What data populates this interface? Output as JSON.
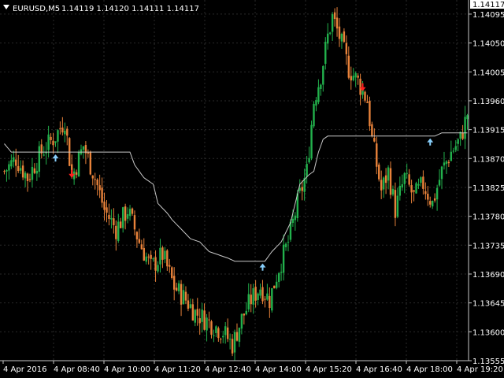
{
  "header": {
    "symbol": "EURUSD,M5",
    "ohlc": "1.14119 1.14120 1.14111 1.14117",
    "collapse_icon": "triangle-down-icon"
  },
  "colors": {
    "background": "#000000",
    "grid": "#2a2a2a",
    "bull": "#22b14c",
    "bear": "#e8823a",
    "ma_line": "#c8c8c8",
    "buy_arrow": "#87cefa",
    "sell_arrow": "#ff2020",
    "axis_text": "#ffffff"
  },
  "chart_data": {
    "type": "candlestick",
    "grid": true,
    "ylim": [
      1.13555,
      1.14117
    ],
    "current_price": "1.14117",
    "y_ticks": [
      "1.14095",
      "1.14050",
      "1.14005",
      "1.13960",
      "1.13915",
      "1.13870",
      "1.13825",
      "1.13780",
      "1.13735",
      "1.13690",
      "1.13645",
      "1.13600",
      "1.13555"
    ],
    "x_ticks": [
      "4 Apr 2016",
      "4 Apr 08:40",
      "4 Apr 10:00",
      "4 Apr 11:20",
      "4 Apr 12:40",
      "4 Apr 14:00",
      "4 Apr 15:20",
      "4 Apr 16:40",
      "4 Apr 18:00",
      "4 Apr 19:20"
    ],
    "close_path": [
      [
        0,
        1.1385
      ],
      [
        5,
        1.1387
      ],
      [
        10,
        1.1384
      ],
      [
        16,
        1.1388
      ],
      [
        22,
        1.13905
      ],
      [
        26,
        1.1393
      ],
      [
        29,
        1.1384
      ],
      [
        34,
        1.1389
      ],
      [
        39,
        1.1384
      ],
      [
        43,
        1.1379
      ],
      [
        48,
        1.1376
      ],
      [
        53,
        1.1379
      ],
      [
        58,
        1.1374
      ],
      [
        63,
        1.137
      ],
      [
        68,
        1.1372
      ],
      [
        73,
        1.1367
      ],
      [
        78,
        1.1365
      ],
      [
        82,
        1.1363
      ],
      [
        86,
        1.1362
      ],
      [
        90,
        1.1361
      ],
      [
        94,
        1.136
      ],
      [
        98,
        1.1358
      ],
      [
        102,
        1.1362
      ],
      [
        106,
        1.1365
      ],
      [
        110,
        1.1367
      ],
      [
        114,
        1.1365
      ],
      [
        118,
        1.137
      ],
      [
        122,
        1.1374
      ],
      [
        126,
        1.138
      ],
      [
        130,
        1.1385
      ],
      [
        133,
        1.1396
      ],
      [
        136,
        1.14
      ],
      [
        139,
        1.1406
      ],
      [
        141,
        1.1409
      ],
      [
        144,
        1.1406
      ],
      [
        148,
        1.1401
      ],
      [
        152,
        1.1399
      ],
      [
        156,
        1.1396
      ],
      [
        158,
        1.139
      ],
      [
        160,
        1.1386
      ],
      [
        162,
        1.1382
      ],
      [
        165,
        1.1385
      ],
      [
        168,
        1.1379
      ],
      [
        172,
        1.1384
      ],
      [
        176,
        1.1381
      ],
      [
        180,
        1.1383
      ],
      [
        184,
        1.138
      ],
      [
        188,
        1.1385
      ],
      [
        192,
        1.1388
      ],
      [
        196,
        1.139
      ],
      [
        199,
        1.1394
      ]
    ],
    "moving_average": [
      [
        0,
        1.13893
      ],
      [
        3,
        1.1388
      ],
      [
        40,
        1.1388
      ],
      [
        54,
        1.1388
      ],
      [
        56,
        1.1386
      ],
      [
        60,
        1.1384
      ],
      [
        64,
        1.1383
      ],
      [
        66,
        1.138
      ],
      [
        70,
        1.13785
      ],
      [
        72,
        1.13775
      ],
      [
        80,
        1.13745
      ],
      [
        84,
        1.1374
      ],
      [
        88,
        1.13725
      ],
      [
        92,
        1.1372
      ],
      [
        96,
        1.13715
      ],
      [
        99,
        1.1371
      ],
      [
        112,
        1.1371
      ],
      [
        113,
        1.13715
      ],
      [
        115,
        1.13725
      ],
      [
        119,
        1.1374
      ],
      [
        123,
        1.1377
      ],
      [
        125,
        1.138
      ],
      [
        127,
        1.1383
      ],
      [
        131,
        1.13845
      ],
      [
        133,
        1.1385
      ],
      [
        135,
        1.1388
      ],
      [
        137,
        1.139
      ],
      [
        139,
        1.13905
      ],
      [
        180,
        1.13905
      ],
      [
        185,
        1.13905
      ],
      [
        188,
        1.1391
      ],
      [
        199,
        1.1391
      ]
    ],
    "signals": [
      {
        "type": "buy",
        "i": 22
      },
      {
        "type": "sell",
        "i": 29
      },
      {
        "type": "buy",
        "i": 111
      },
      {
        "type": "sell",
        "i": 154
      },
      {
        "type": "buy",
        "i": 183
      }
    ]
  }
}
